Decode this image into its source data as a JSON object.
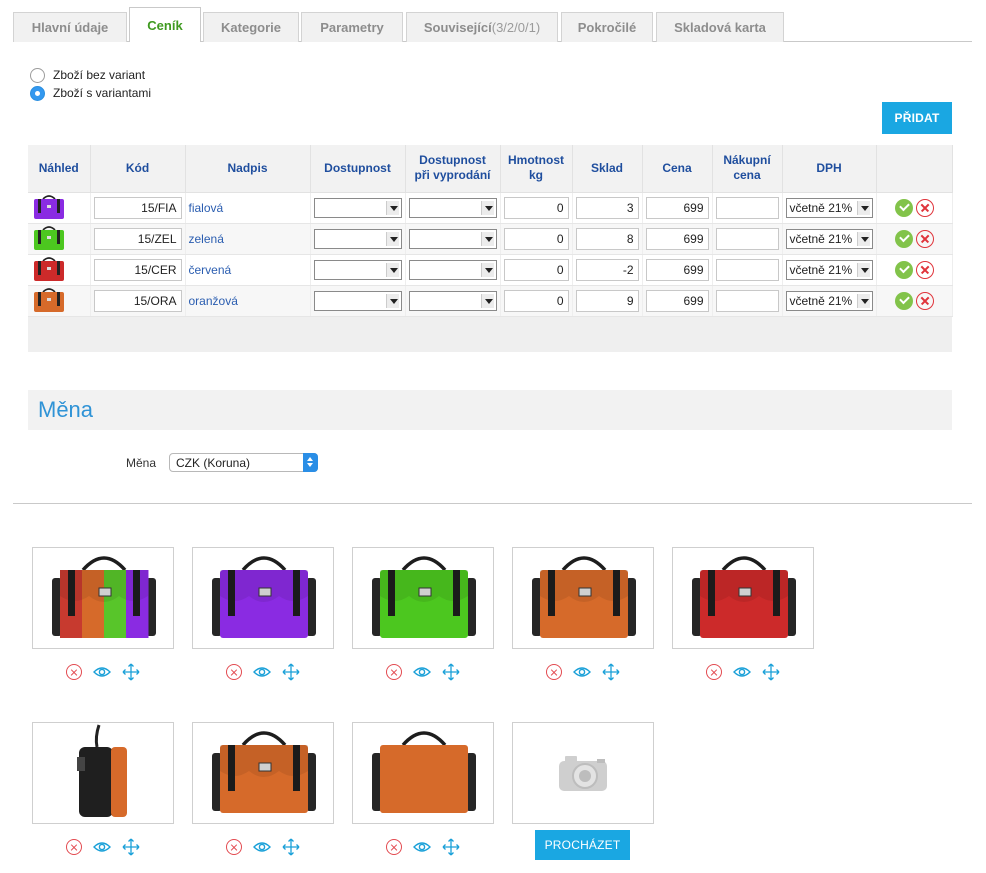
{
  "tabs": [
    {
      "label": "Hlavní údaje",
      "count": ""
    },
    {
      "label": "Ceník",
      "count": ""
    },
    {
      "label": "Kategorie",
      "count": ""
    },
    {
      "label": "Parametry",
      "count": ""
    },
    {
      "label": "Související",
      "count": " (3/2/0/1)"
    },
    {
      "label": "Pokročilé",
      "count": ""
    },
    {
      "label": "Skladová karta",
      "count": ""
    }
  ],
  "variant_mode": {
    "options": [
      "Zboží bez variant",
      "Zboží s variantami"
    ],
    "selected": "Zboží s variantami"
  },
  "add_button": "PŘIDAT",
  "table": {
    "headers": {
      "preview": "Náhled",
      "code": "Kód",
      "label": "Nadpis",
      "availability": "Dostupnost",
      "availability_sold_1": "Dostupnost",
      "availability_sold_2": "při vyprodání",
      "weight_1": "Hmotnost",
      "weight_2": "kg",
      "stock": "Sklad",
      "price": "Cena",
      "purchase_1": "Nákupní",
      "purchase_2": "cena",
      "vat": "DPH"
    },
    "rows": [
      {
        "code": "15/FIA",
        "label": "fialová",
        "weight": "0",
        "stock": "3",
        "price": "699",
        "purchase": "",
        "vat": "včetně 21%",
        "color": "#8a2be2"
      },
      {
        "code": "15/ZEL",
        "label": "zelená",
        "weight": "0",
        "stock": "8",
        "price": "699",
        "purchase": "",
        "vat": "včetně 21%",
        "color": "#4cc71f"
      },
      {
        "code": "15/CER",
        "label": "červená",
        "weight": "0",
        "stock": "-2",
        "price": "699",
        "purchase": "",
        "vat": "včetně 21%",
        "color": "#cc2a2a"
      },
      {
        "code": "15/ORA",
        "label": "oranžová",
        "weight": "0",
        "stock": "9",
        "price": "699",
        "purchase": "",
        "vat": "včetně 21%",
        "color": "#d66a2a"
      }
    ]
  },
  "currency": {
    "section_title": "Měna",
    "label": "Měna",
    "value": "CZK (Koruna)"
  },
  "gallery": {
    "browse_button": "PROCHÁZET",
    "images": [
      {
        "kind": "multi",
        "colors": [
          "#c73a2f",
          "#d66a2a",
          "#58c52a",
          "#8a2be2"
        ]
      },
      {
        "kind": "front",
        "colors": [
          "#8a2be2"
        ]
      },
      {
        "kind": "front",
        "colors": [
          "#4cc71f"
        ]
      },
      {
        "kind": "front",
        "colors": [
          "#d66a2a"
        ]
      },
      {
        "kind": "front",
        "colors": [
          "#cc2a2a"
        ]
      },
      {
        "kind": "side",
        "colors": [
          "#d66a2a"
        ]
      },
      {
        "kind": "angle",
        "colors": [
          "#d66a2a"
        ]
      },
      {
        "kind": "back",
        "colors": [
          "#d66a2a"
        ]
      }
    ]
  },
  "colors": {
    "accent_blue": "#1aa7e2",
    "header_text": "#1f4e9e",
    "active_tab": "#3f9a20",
    "ok_green": "#82c34a",
    "delete_red": "#e0343b",
    "eye_blue": "#1aa0d8"
  }
}
